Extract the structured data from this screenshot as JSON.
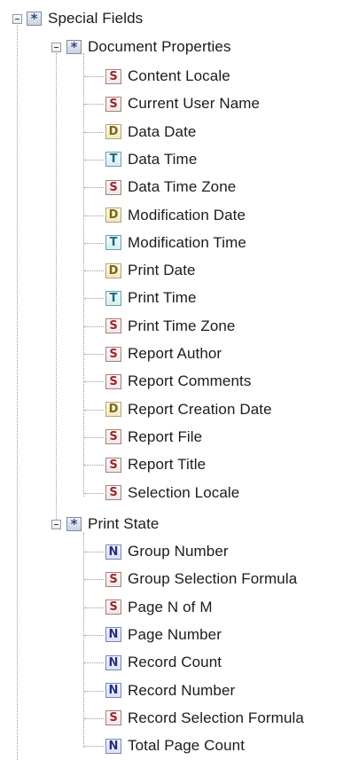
{
  "tree": {
    "root": {
      "label": "Special Fields",
      "icon": "asterisk-folder-icon",
      "groups": [
        {
          "label": "Document Properties",
          "icon": "asterisk-folder-icon",
          "items": [
            {
              "label": "Content Locale",
              "type": "S"
            },
            {
              "label": "Current User Name",
              "type": "S"
            },
            {
              "label": "Data Date",
              "type": "D"
            },
            {
              "label": "Data Time",
              "type": "T"
            },
            {
              "label": "Data Time Zone",
              "type": "S"
            },
            {
              "label": "Modification Date",
              "type": "D"
            },
            {
              "label": "Modification Time",
              "type": "T"
            },
            {
              "label": "Print Date",
              "type": "D"
            },
            {
              "label": "Print Time",
              "type": "T"
            },
            {
              "label": "Print Time Zone",
              "type": "S"
            },
            {
              "label": "Report Author",
              "type": "S"
            },
            {
              "label": "Report Comments",
              "type": "S"
            },
            {
              "label": "Report Creation Date",
              "type": "D"
            },
            {
              "label": "Report File",
              "type": "S"
            },
            {
              "label": "Report Title",
              "type": "S"
            },
            {
              "label": "Selection Locale",
              "type": "S"
            }
          ]
        },
        {
          "label": "Print State",
          "icon": "asterisk-folder-icon",
          "items": [
            {
              "label": "Group Number",
              "type": "N"
            },
            {
              "label": "Group Selection Formula",
              "type": "S"
            },
            {
              "label": "Page N of M",
              "type": "S"
            },
            {
              "label": "Page Number",
              "type": "N"
            },
            {
              "label": "Record Count",
              "type": "N"
            },
            {
              "label": "Record Number",
              "type": "N"
            },
            {
              "label": "Record Selection Formula",
              "type": "S"
            },
            {
              "label": "Total Page Count",
              "type": "N"
            }
          ]
        }
      ]
    },
    "folder_glyph": "*",
    "colors": {
      "string": "#a2242a",
      "date": "#7a6510",
      "time": "#1c6a7a",
      "number": "#1f2f8a",
      "folder": "#2f4a7a"
    }
  }
}
